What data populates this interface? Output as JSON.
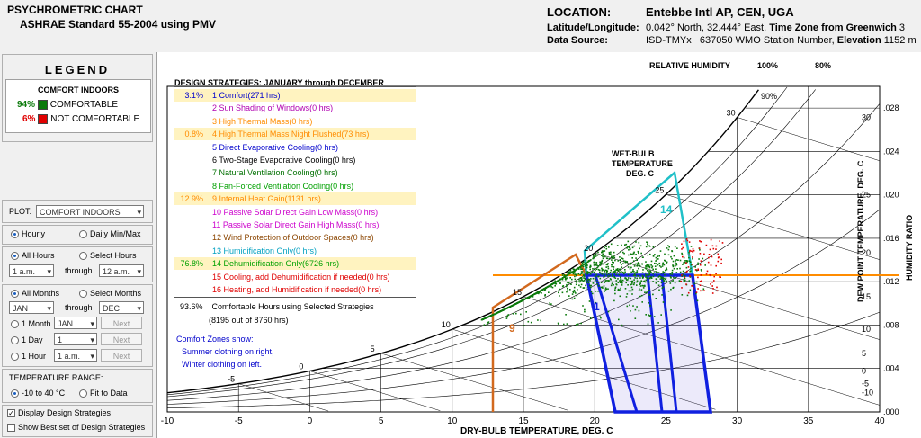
{
  "header": {
    "title_line1": "PSYCHROMETRIC CHART",
    "title_line2": "ASHRAE Standard 55-2004 using PMV",
    "location_label": "LOCATION:",
    "location_value": "Entebbe Intl AP, CEN, UGA",
    "latlon_label": "Latitude/Longitude:",
    "lat": "0.042° North, 32.444° East,",
    "tz_label": "Time Zone from Greenwich",
    "tz_value": "3",
    "datasource_label": "Data Source:",
    "datasource_type": "ISD-TMYx",
    "station": "637050 WMO Station Number,",
    "elev_label": "Elevation",
    "elev_value": "1152 m"
  },
  "legend": {
    "title": "LEGEND",
    "subtitle": "COMFORT INDOORS",
    "comfortable_pct": "94%",
    "comfortable_label": "COMFORTABLE",
    "not_pct": "6%",
    "not_label": "NOT COMFORTABLE",
    "comfortable_color": "#0b7a0b",
    "not_color": "#e00000"
  },
  "controls": {
    "plot_label": "PLOT:",
    "plot_value": "COMFORT INDOORS",
    "hourly": "Hourly",
    "daily": "Daily Min/Max",
    "all_hours": "All Hours",
    "select_hours": "Select Hours",
    "hour_from": "1 a.m.",
    "through": "through",
    "hour_to": "12 a.m.",
    "all_months": "All Months",
    "select_months": "Select Months",
    "month_from": "JAN",
    "month_to": "DEC",
    "one_month": "1 Month",
    "one_month_val": "JAN",
    "next": "Next",
    "one_day": "1 Day",
    "one_day_val": "1",
    "one_hour": "1 Hour",
    "one_hour_val": "1 a.m.",
    "temp_range_label": "TEMPERATURE RANGE:",
    "temp_range_opt1": "-10 to 40 °C",
    "temp_range_opt2": "Fit to Data",
    "display_strategies": "Display Design Strategies",
    "show_best": "Show Best set of Design Strategies"
  },
  "strategies": {
    "heading": "DESIGN STRATEGIES:  JANUARY through DECEMBER",
    "items": [
      {
        "pct": "3.1%",
        "label": "1  Comfort(271 hrs)",
        "color": "#0000cc",
        "hl": true
      },
      {
        "pct": "",
        "label": "2  Sun Shading of Windows(0 hrs)",
        "color": "#b000b0",
        "hl": false
      },
      {
        "pct": "",
        "label": "3  High Thermal Mass(0 hrs)",
        "color": "#ff8c00",
        "hl": false
      },
      {
        "pct": "0.8%",
        "label": "4  High Thermal Mass Night Flushed(73 hrs)",
        "color": "#ff8c00",
        "hl": true
      },
      {
        "pct": "",
        "label": "5  Direct Evaporative Cooling(0 hrs)",
        "color": "#0000cc",
        "hl": false
      },
      {
        "pct": "",
        "label": "6  Two-Stage Evaporative Cooling(0 hrs)",
        "color": "#000000",
        "hl": false
      },
      {
        "pct": "",
        "label": "7  Natural Ventilation Cooling(0 hrs)",
        "color": "#007000",
        "hl": false
      },
      {
        "pct": "",
        "label": "8  Fan-Forced Ventilation Cooling(0 hrs)",
        "color": "#00a000",
        "hl": false
      },
      {
        "pct": "12.9%",
        "label": "9  Internal Heat Gain(1131 hrs)",
        "color": "#ff8c00",
        "hl": true
      },
      {
        "pct": "",
        "label": "10  Passive Solar Direct Gain Low Mass(0 hrs)",
        "color": "#cc00cc",
        "hl": false
      },
      {
        "pct": "",
        "label": "11  Passive Solar Direct Gain High Mass(0 hrs)",
        "color": "#cc00cc",
        "hl": false
      },
      {
        "pct": "",
        "label": "12  Wind Protection of Outdoor Spaces(0 hrs)",
        "color": "#8b4500",
        "hl": false
      },
      {
        "pct": "",
        "label": "13  Humidification Only(0 hrs)",
        "color": "#00a0c0",
        "hl": false
      },
      {
        "pct": "76.8%",
        "label": "14  Dehumidification Only(6726 hrs)",
        "color": "#00a000",
        "hl": true
      },
      {
        "pct": "",
        "label": "15  Cooling, add Dehumidification if needed(0 hrs)",
        "color": "#e00000",
        "hl": false
      },
      {
        "pct": "",
        "label": "16  Heating, add Humidification if needed(0 hrs)",
        "color": "#e00000",
        "hl": false
      }
    ],
    "summary_pct": "93.6%",
    "summary_text": "Comfortable Hours using Selected Strategies",
    "summary_hours": "(8195 out of 8760 hrs)",
    "comfort_note_1": "Comfort Zones show:",
    "comfort_note_2": "Summer clothing on right,",
    "comfort_note_3": "Winter clothing on left."
  },
  "chart": {
    "rh_label": "RELATIVE HUMIDITY",
    "rh_100": "100%",
    "rh_80": "80%",
    "rh_90": "90%",
    "wetbulb_1": "WET-BULB",
    "wetbulb_2": "TEMPERATURE",
    "wetbulb_3": "DEG. C",
    "xlabel": "DRY-BULB TEMPERATURE, DEG. C",
    "ylabel_dp": "DEW POINT TEMPERATURE, DEG. C",
    "ylabel_hr": "HUMIDITY RATIO",
    "xticks": [
      "-10",
      "-5",
      "0",
      "5",
      "10",
      "15",
      "20",
      "25",
      "30",
      "35",
      "40"
    ],
    "dpticks": [
      "30",
      "25",
      "20",
      "15",
      "10",
      "5",
      "0",
      "-5",
      "-10"
    ],
    "hrticks": [
      ".028",
      ".024",
      ".020",
      ".016",
      ".012",
      ".008",
      ".004",
      ".000"
    ],
    "wb_labels": [
      "30",
      "25",
      "20",
      "15",
      "10",
      "5",
      "0",
      "-5"
    ],
    "zone_labels": {
      "z1": "1",
      "z9": "9",
      "z14": "14"
    }
  },
  "chart_data": {
    "type": "scatter",
    "title": "PSYCHROMETRIC CHART",
    "xlabel": "DRY-BULB TEMPERATURE, DEG. C",
    "ylabel": "HUMIDITY RATIO",
    "xlim": [
      -10,
      40
    ],
    "ylim": [
      0,
      0.03
    ],
    "series": [
      {
        "name": "COMFORTABLE",
        "color": "#0b7a0b",
        "x_range": [
          12,
          28
        ],
        "y_range": [
          0.008,
          0.016
        ]
      },
      {
        "name": "NOT COMFORTABLE",
        "color": "#e00000",
        "x_range": [
          26,
          29
        ],
        "y_range": [
          0.011,
          0.016
        ]
      }
    ]
  }
}
